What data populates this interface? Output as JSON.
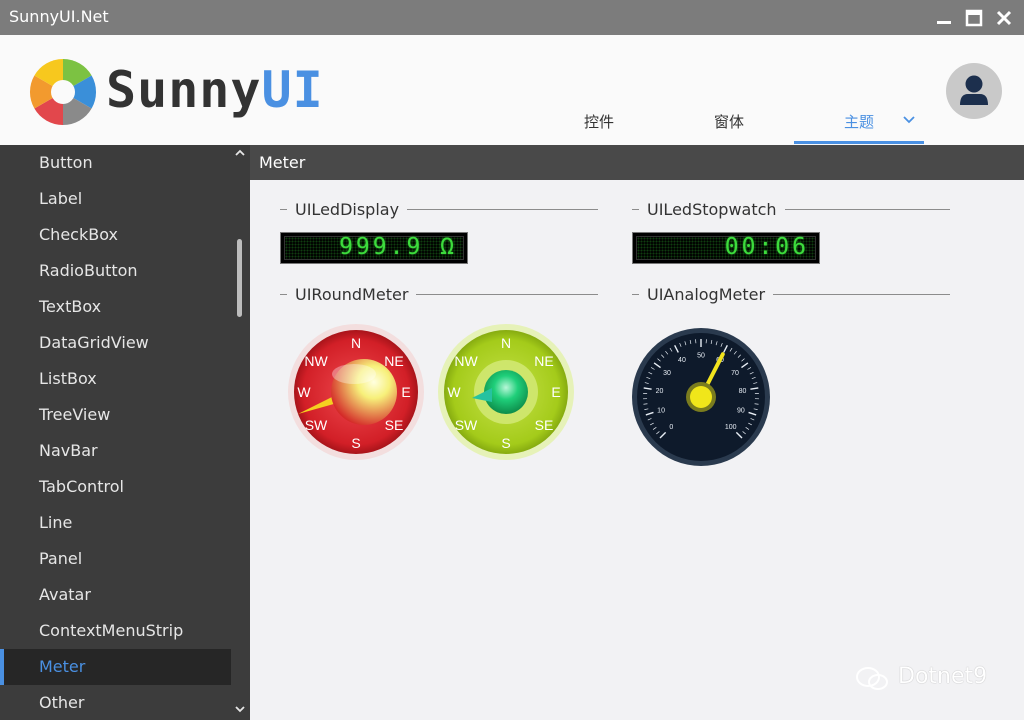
{
  "window": {
    "title": "SunnyUI.Net"
  },
  "logo": {
    "text_main": "Sunny",
    "text_accent": "UI"
  },
  "tabs": [
    {
      "label": "控件",
      "active": false
    },
    {
      "label": "窗体",
      "active": false
    },
    {
      "label": "主题",
      "active": true
    }
  ],
  "sidebar": {
    "items": [
      {
        "label": "Button"
      },
      {
        "label": "Label"
      },
      {
        "label": "CheckBox"
      },
      {
        "label": "RadioButton"
      },
      {
        "label": "TextBox"
      },
      {
        "label": "DataGridView"
      },
      {
        "label": "ListBox"
      },
      {
        "label": "TreeView"
      },
      {
        "label": "NavBar"
      },
      {
        "label": "TabControl"
      },
      {
        "label": "Line"
      },
      {
        "label": "Panel"
      },
      {
        "label": "Avatar"
      },
      {
        "label": "ContextMenuStrip"
      },
      {
        "label": "Meter",
        "active": true
      },
      {
        "label": "Other"
      }
    ]
  },
  "panel": {
    "title": "Meter"
  },
  "groups": {
    "led_display": {
      "title": "UILedDisplay",
      "value": "999.9 Ω"
    },
    "led_stopwatch": {
      "title": "UILedStopwatch",
      "value": "00:06"
    },
    "round_meter": {
      "title": "UIRoundMeter",
      "directions": [
        "N",
        "NE",
        "E",
        "SE",
        "S",
        "SW",
        "W",
        "NW"
      ]
    },
    "analog_meter": {
      "title": "UIAnalogMeter",
      "ticks": [
        "0",
        "10",
        "20",
        "30",
        "40",
        "50",
        "60",
        "70",
        "80",
        "90",
        "100"
      ],
      "value": 60
    }
  },
  "watermark": {
    "text": "Dotnet9"
  },
  "colors": {
    "accent": "#4a90e2",
    "sidebar_bg": "#3c3c3c",
    "led_green": "#3ddc3d",
    "meter_red": "#d9272e",
    "meter_green": "#a8cf20"
  }
}
